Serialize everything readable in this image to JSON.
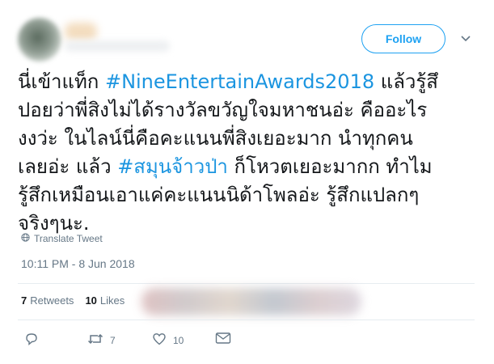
{
  "header": {
    "follow_label": "Follow"
  },
  "tweet": {
    "segments": [
      {
        "text": "นี่เข้าแท็ก ",
        "hashtag": false
      },
      {
        "text": "#NineEntertainAwards2018",
        "hashtag": true
      },
      {
        "text": " แล้วรู้สึ\nปอยว่าพี่สิงไม่ได้รางวัลขวัญใจมหาชนอ่ะ คืออะไร\nงงว่ะ ในไลน์นี่คือคะแนนพี่สิงเยอะมาก นำทุกคน\nเลยอ่ะ แล้ว ",
        "hashtag": false
      },
      {
        "text": "#สมุนจ้าวป่า",
        "hashtag": true
      },
      {
        "text": " ก็โหวตเยอะมากก ทำไม\nรู้สึกเหมือนเอาแค่คะแนนนิด้าโพลอ่ะ รู้สึกแปลกๆ\nจริงๆนะ.",
        "hashtag": false
      }
    ],
    "translate_label": "Translate Tweet",
    "timestamp": "10:11 PM - 8 Jun 2018"
  },
  "stats": {
    "retweets_count": "7",
    "retweets_label": "Retweets",
    "likes_count": "10",
    "likes_label": "Likes"
  },
  "actions": {
    "retweet_count": "7",
    "like_count": "10"
  },
  "colors": {
    "accent": "#1da1f2",
    "hashtag": "#1b95e0",
    "muted": "#657786"
  },
  "icons": [
    "chevron-down-icon",
    "globe-icon",
    "reply-icon",
    "retweet-icon",
    "heart-icon",
    "mail-icon"
  ]
}
